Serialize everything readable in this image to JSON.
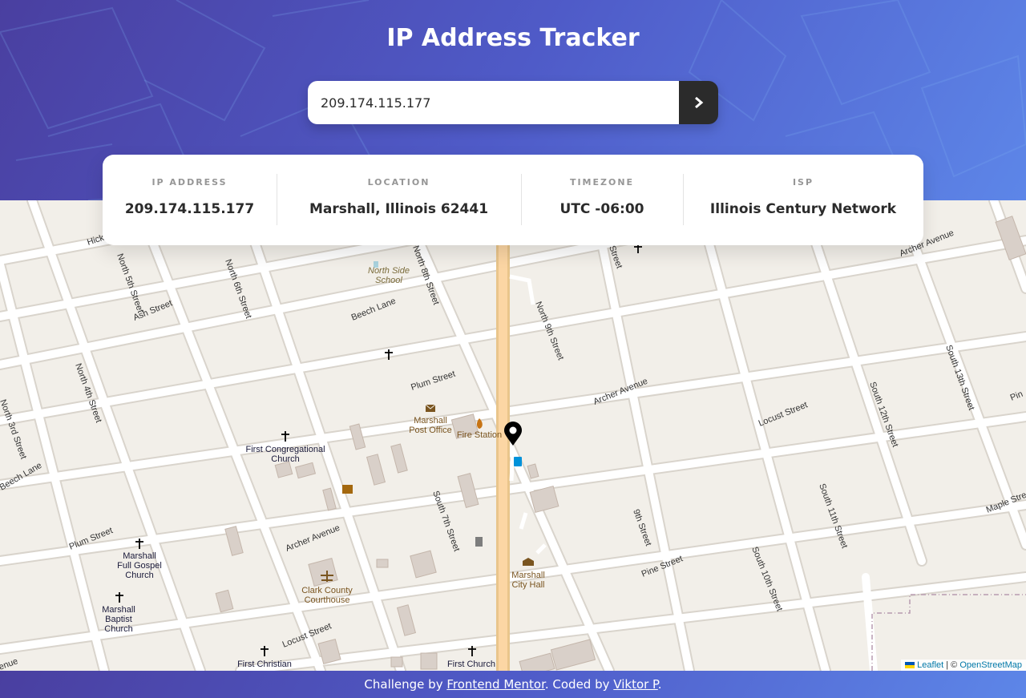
{
  "header": {
    "title": "IP Address Tracker",
    "search": {
      "value": "209.174.115.177",
      "submit_icon": "chevron-right-icon"
    },
    "accent": "#2b2b2b"
  },
  "info": {
    "ip_label": "IP ADDRESS",
    "ip_value": "209.174.115.177",
    "location_label": "LOCATION",
    "location_value": "Marshall, Illinois 62441",
    "timezone_label": "TIMEZONE",
    "timezone_value": "UTC -06:00",
    "isp_label": "ISP",
    "isp_value": "Illinois Century Network"
  },
  "map": {
    "marker_icon": "location-pin-icon",
    "streets": {
      "north_5th": "North 5th Street",
      "north_6th": "North 6th Street",
      "north_8th": "North 8th Street",
      "north_9th": "North 9th Street",
      "north_4th": "North 4th Street",
      "north_3rd": "North 3rd Street",
      "ash": "Ash Street",
      "beech1": "Beech Lane",
      "beech2": "Beech Lane",
      "plum1": "Plum Street",
      "plum2": "Plum Street",
      "archer1": "Archer Avenue",
      "archer2": "Archer Avenue",
      "archer3": "Archer Avenue",
      "locust1": "Locust Street",
      "locust2": "Locust Street",
      "pine": "Pine Street",
      "south_7th": "South 7th Street",
      "ninth": "9th Street",
      "south_10th": "South 10th Street",
      "south_11th": "South 11th Street",
      "south_12th": "South 12th Street",
      "south_13th": "South 13th Street",
      "maple": "Maple Street",
      "hickory": "Hick",
      "north_street": "Street",
      "pine_edge": "Pin",
      "queue": "enue"
    },
    "places": {
      "school1": "North Side",
      "school2": "School",
      "post1": "Marshall",
      "post2": "Post Office",
      "fire": "Fire Station",
      "fcc1": "First Congregational",
      "fcc2": "Church",
      "mfg1": "Marshall",
      "mfg2": "Full Gospel",
      "mfg3": "Church",
      "mbc1": "Marshall",
      "mbc2": "Baptist",
      "mbc3": "Church",
      "court1": "Clark County",
      "court2": "Courthouse",
      "hall1": "Marshall",
      "hall2": "City Hall",
      "fchristian": "First Christian",
      "fchurch": "First Church"
    },
    "attribution": {
      "leaflet": "Leaflet",
      "separator": "| ©",
      "osm": "OpenStreetMap"
    }
  },
  "footer": {
    "prefix": "Challenge by",
    "link1": "Frontend Mentor",
    "middle": ". Coded by",
    "link2": "Viktor P",
    "suffix": "."
  }
}
